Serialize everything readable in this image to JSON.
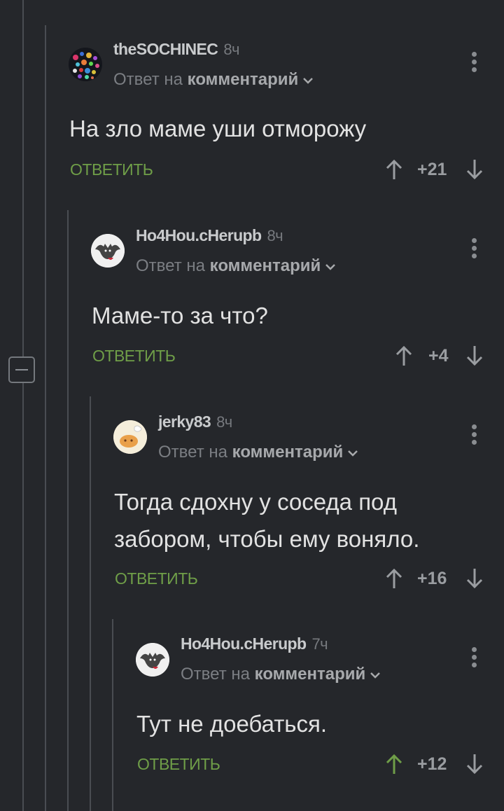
{
  "comments": [
    {
      "author": "theSOCHINEC",
      "time": "8ч",
      "reply_prefix": "Ответ на",
      "reply_target": "комментарий",
      "text": "На зло маме уши отморожу",
      "reply_label": "ОТВЕТИТЬ",
      "rating": "+21",
      "upvoted": false
    },
    {
      "author": "Ho4Hou.cHerupb",
      "time": "8ч",
      "reply_prefix": "Ответ на",
      "reply_target": "комментарий",
      "text": "Маме-то за что?",
      "reply_label": "ОТВЕТИТЬ",
      "rating": "+4",
      "upvoted": false
    },
    {
      "author": "jerky83",
      "time": "8ч",
      "reply_prefix": "Ответ на",
      "reply_target": "комментарий",
      "text": "Тогда сдохну у соседа под забором, чтобы ему воняло.",
      "reply_label": "ОТВЕТИТЬ",
      "rating": "+16",
      "upvoted": false
    },
    {
      "author": "Ho4Hou.cHerupb",
      "time": "7ч",
      "reply_prefix": "Ответ на",
      "reply_target": "комментарий",
      "text": "Тут не доебаться.",
      "reply_label": "ОТВЕТИТЬ",
      "rating": "+12",
      "upvoted": true
    }
  ],
  "colors": {
    "background": "#25272b",
    "reply_green": "#6f9e48",
    "upvote_active": "#6f9e48",
    "thread_line": "#4a4d52"
  },
  "icons": {
    "collapse": "minus-square-icon",
    "more": "vertical-dots-icon",
    "upvote": "arrow-up-icon",
    "downvote": "arrow-down-icon",
    "chevron": "chevron-down-icon"
  }
}
